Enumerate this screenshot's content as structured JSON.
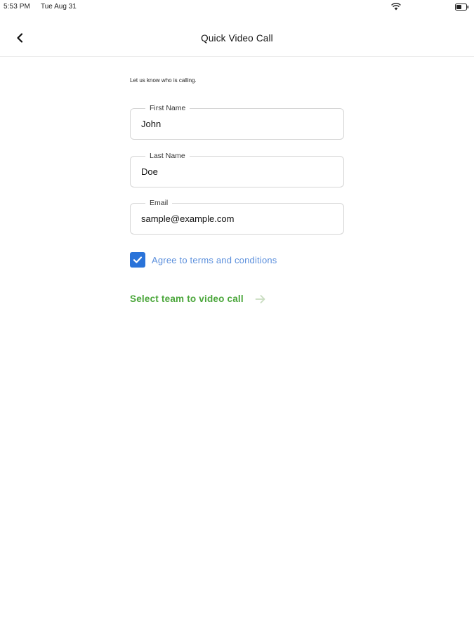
{
  "status_bar": {
    "time": "5:53 PM",
    "date": "Tue Aug 31",
    "wifi_icon": "wifi-icon",
    "battery_icon": "battery-icon"
  },
  "nav": {
    "back_icon": "chevron-left-icon",
    "title": "Quick Video Call"
  },
  "form": {
    "intro": "Let us know who is calling.",
    "first_name": {
      "label": "First Name",
      "value": "John"
    },
    "last_name": {
      "label": "Last Name",
      "value": "Doe"
    },
    "email": {
      "label": "Email",
      "value": "sample@example.com"
    },
    "terms": {
      "label": "Agree to terms and conditions",
      "checked": true
    },
    "select_team": {
      "label": "Select team to video call",
      "icon": "arrow-right-icon"
    }
  },
  "colors": {
    "checkbox": "#2a73d9",
    "terms_link": "#5b8fdc",
    "select_team": "#4aa63a",
    "arrow": "#c9ddc0"
  }
}
